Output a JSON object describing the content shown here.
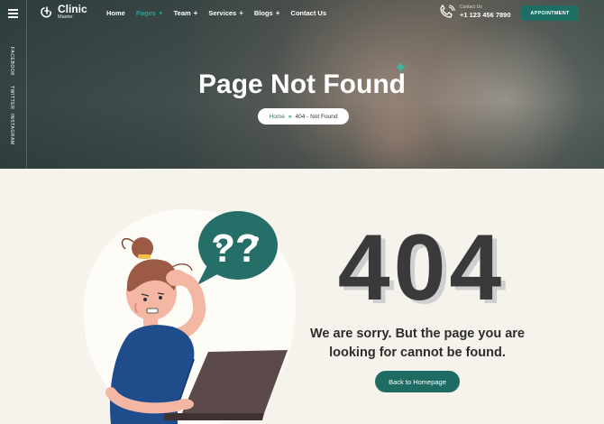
{
  "brand": {
    "name": "Clinic",
    "tagline": "Master"
  },
  "nav": {
    "items": [
      {
        "label": "Home",
        "plus": ""
      },
      {
        "label": "Pages",
        "plus": "+"
      },
      {
        "label": "Team",
        "plus": "+"
      },
      {
        "label": "Services",
        "plus": "+"
      },
      {
        "label": "Blogs",
        "plus": "+"
      },
      {
        "label": "Contact Us",
        "plus": ""
      }
    ],
    "active": "Pages"
  },
  "contact": {
    "label": "Contact Us",
    "phone": "+1 123 456 7890"
  },
  "appointment_label": "APPOINTMENT",
  "social": [
    "FACEBOOK",
    "TWITTER",
    "INSTAGRAM"
  ],
  "hero": {
    "title": "Page Not Found",
    "breadcrumb": {
      "home": "Home",
      "separator": "»",
      "current": "404 - Not Found"
    }
  },
  "error": {
    "code": "404",
    "line1": "We are sorry. But the page you are",
    "line2": "looking for cannot be found.",
    "button": "Back to Homepage"
  },
  "colors": {
    "accent": "#1e6e66",
    "accent_light": "#2aa394",
    "background": "#f6f3ec",
    "text": "#3a3a3a"
  }
}
